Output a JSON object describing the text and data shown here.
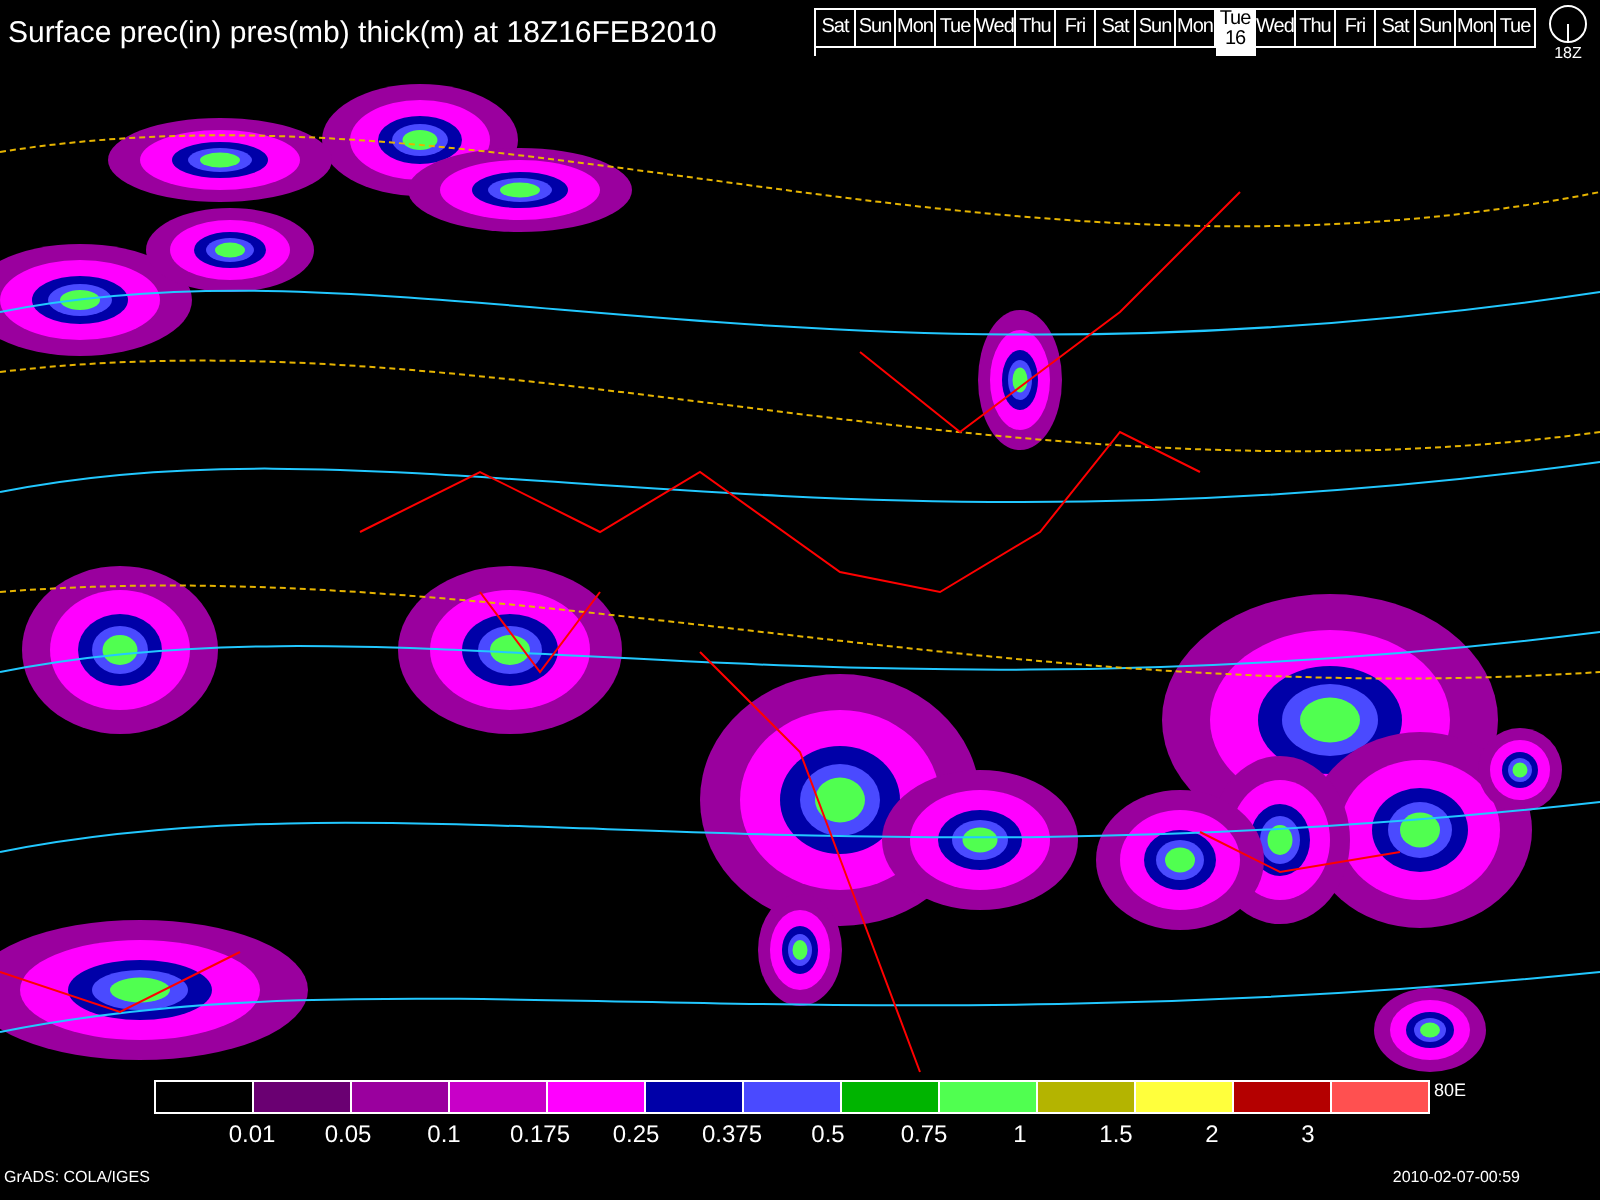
{
  "title": "Surface prec(in) pres(mb) thick(m) at 18Z16FEB2010",
  "days": [
    {
      "label": "Sat",
      "selected": false
    },
    {
      "label": "Sun",
      "selected": false
    },
    {
      "label": "Mon",
      "selected": false
    },
    {
      "label": "Tue",
      "selected": false
    },
    {
      "label": "Wed",
      "selected": false
    },
    {
      "label": "Thu",
      "selected": false
    },
    {
      "label": "Fri",
      "selected": false
    },
    {
      "label": "Sat",
      "selected": false
    },
    {
      "label": "Sun",
      "selected": false
    },
    {
      "label": "Mon",
      "selected": false
    },
    {
      "label": "Tue",
      "selected": true,
      "date": "16"
    },
    {
      "label": "Wed",
      "selected": false
    },
    {
      "label": "Thu",
      "selected": false
    },
    {
      "label": "Fri",
      "selected": false
    },
    {
      "label": "Sat",
      "selected": false
    },
    {
      "label": "Sun",
      "selected": false
    },
    {
      "label": "Mon",
      "selected": false
    },
    {
      "label": "Tue",
      "selected": false
    }
  ],
  "clock": {
    "label": "18Z"
  },
  "legend": {
    "bins": [
      {
        "color": "#000000"
      },
      {
        "color": "#6a0072"
      },
      {
        "color": "#9a009e"
      },
      {
        "color": "#c800c8"
      },
      {
        "color": "#ff00ff"
      },
      {
        "color": "#0000a8"
      },
      {
        "color": "#4a4aff"
      },
      {
        "color": "#00b400"
      },
      {
        "color": "#50ff50"
      },
      {
        "color": "#b4b400"
      },
      {
        "color": "#ffff3c"
      },
      {
        "color": "#b40000"
      },
      {
        "color": "#ff5050"
      }
    ],
    "labels": [
      "0.01",
      "0.05",
      "0.1",
      "0.175",
      "0.25",
      "0.375",
      "0.5",
      "0.75",
      "1",
      "1.5",
      "2",
      "3"
    ],
    "longitude_label": "80E"
  },
  "footer": {
    "credit": "GrADS: COLA/IGES",
    "timestamp": "2010-02-07-00:59"
  }
}
